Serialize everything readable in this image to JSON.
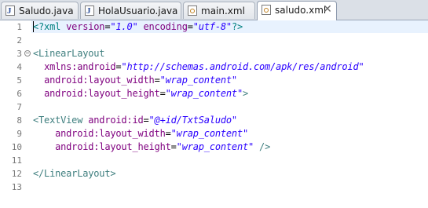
{
  "tabs": [
    {
      "label": "Saludo.java",
      "icon": "java-file-icon",
      "active": false
    },
    {
      "label": "HolaUsuario.java",
      "icon": "java-file-icon",
      "active": false
    },
    {
      "label": "main.xml",
      "icon": "xml-file-icon",
      "active": false
    },
    {
      "label": "saludo.xml",
      "icon": "xml-file-icon",
      "active": true,
      "close_glyph": "✕"
    }
  ],
  "editor": {
    "lines": [
      {
        "n": "1",
        "tokens": [
          {
            "t": "<?xml ",
            "c": "pi"
          },
          {
            "t": "version",
            "c": "attr"
          },
          {
            "t": "=",
            "c": "plain"
          },
          {
            "t": "\"1.0\"",
            "c": "val"
          },
          {
            "t": " ",
            "c": "plain"
          },
          {
            "t": "encoding",
            "c": "attr"
          },
          {
            "t": "=",
            "c": "plain"
          },
          {
            "t": "\"utf-8\"",
            "c": "val"
          },
          {
            "t": "?>",
            "c": "pi"
          }
        ]
      },
      {
        "n": "2",
        "tokens": []
      },
      {
        "n": "3",
        "fold": "−",
        "tokens": [
          {
            "t": "<LinearLayout",
            "c": "tag"
          }
        ]
      },
      {
        "n": "4",
        "tokens": [
          {
            "t": "  ",
            "c": "plain"
          },
          {
            "t": "xmlns:android",
            "c": "attr"
          },
          {
            "t": "=",
            "c": "plain"
          },
          {
            "t": "\"http://schemas.android.com/apk/res/android\"",
            "c": "val"
          }
        ]
      },
      {
        "n": "5",
        "tokens": [
          {
            "t": "  ",
            "c": "plain"
          },
          {
            "t": "android:layout_width",
            "c": "attr"
          },
          {
            "t": "=",
            "c": "plain"
          },
          {
            "t": "\"wrap_content\"",
            "c": "val"
          }
        ]
      },
      {
        "n": "6",
        "tokens": [
          {
            "t": "  ",
            "c": "plain"
          },
          {
            "t": "android:layout_height",
            "c": "attr"
          },
          {
            "t": "=",
            "c": "plain"
          },
          {
            "t": "\"wrap_content\"",
            "c": "val"
          },
          {
            "t": ">",
            "c": "tag"
          }
        ]
      },
      {
        "n": "7",
        "tokens": []
      },
      {
        "n": "8",
        "tokens": [
          {
            "t": "<TextView ",
            "c": "tag"
          },
          {
            "t": "android:id",
            "c": "attr"
          },
          {
            "t": "=",
            "c": "plain"
          },
          {
            "t": "\"@+id/TxtSaludo\"",
            "c": "val"
          }
        ]
      },
      {
        "n": "9",
        "tokens": [
          {
            "t": "    ",
            "c": "plain"
          },
          {
            "t": "android:layout_width",
            "c": "attr"
          },
          {
            "t": "=",
            "c": "plain"
          },
          {
            "t": "\"wrap_content\"",
            "c": "val"
          }
        ]
      },
      {
        "n": "10",
        "tokens": [
          {
            "t": "    ",
            "c": "plain"
          },
          {
            "t": "android:layout_height",
            "c": "attr"
          },
          {
            "t": "=",
            "c": "plain"
          },
          {
            "t": "\"wrap_content\"",
            "c": "val"
          },
          {
            "t": " />",
            "c": "tag"
          }
        ]
      },
      {
        "n": "11",
        "tokens": []
      },
      {
        "n": "12",
        "tokens": [
          {
            "t": "</LinearLayout>",
            "c": "tag"
          }
        ]
      },
      {
        "n": "13",
        "tokens": []
      }
    ]
  }
}
